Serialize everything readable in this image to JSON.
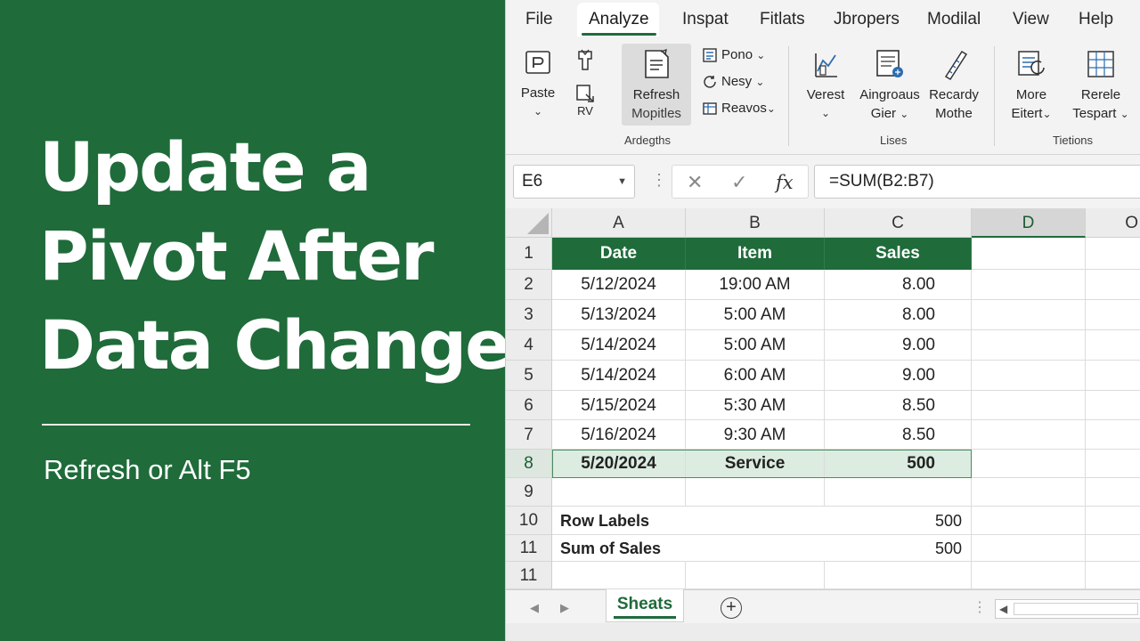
{
  "hero": {
    "title_lines": [
      "Update a",
      "Pivot After",
      "Data Changes"
    ],
    "subtitle": "Refresh or Alt F5"
  },
  "menu": {
    "items": [
      "File",
      "Analyze",
      "Inspat",
      "Fitlats",
      "Jbropers",
      "Modilal",
      "View",
      "Help"
    ],
    "active": "Analyze"
  },
  "ribbon": {
    "paste": {
      "label": "Paste"
    },
    "sub_small": {
      "label": "RV"
    },
    "refresh": {
      "line1": "Refresh",
      "line2": "Mopitles"
    },
    "pono": {
      "label": "Pono"
    },
    "nesy": {
      "label": "Nesy"
    },
    "reavos": {
      "label": "Reavos"
    },
    "group1_label": "Ardegths",
    "verest": {
      "label": "Verest"
    },
    "aingroaus": {
      "line1": "Aingroaus",
      "line2": "Gier"
    },
    "recardy": {
      "line1": "Recardy",
      "line2": "Mothe"
    },
    "group2_label": "Lises",
    "more": {
      "line1": "More",
      "line2": "Eitert"
    },
    "rerele": {
      "line1": "Rerele",
      "line2": "Tespart"
    },
    "group3_label": "Tietions"
  },
  "formula_bar": {
    "name_box": "E6",
    "cancel_icon": "✕",
    "enter_icon": "✓",
    "fx": "fx",
    "formula": "=SUM(B2:B7)"
  },
  "columns": [
    "A",
    "B",
    "C",
    "D",
    "O"
  ],
  "selected_column": "D",
  "table": {
    "headers": [
      "Date",
      "Item",
      "Sales"
    ],
    "rows": [
      {
        "row": "2",
        "date": "5/12/2024",
        "item": "19:00 AM",
        "sales": "8.00"
      },
      {
        "row": "3",
        "date": "5/13/2024",
        "item": "5:00 AM",
        "sales": "8.00"
      },
      {
        "row": "4",
        "date": "5/14/2024",
        "item": "5:00 AM",
        "sales": "9.00"
      },
      {
        "row": "5",
        "date": "5/14/2024",
        "item": "6:00 AM",
        "sales": "9.00"
      },
      {
        "row": "6",
        "date": "5/15/2024",
        "item": "5:30 AM",
        "sales": "8.50"
      },
      {
        "row": "7",
        "date": "5/16/2024",
        "item": "9:30 AM",
        "sales": "8.50"
      },
      {
        "row": "8",
        "date": "5/20/2024",
        "item": "Service",
        "sales": "500"
      }
    ]
  },
  "row_numbers": [
    "1",
    "2",
    "3",
    "4",
    "5",
    "6",
    "7",
    "8",
    "9",
    "10",
    "11",
    "11"
  ],
  "selected_row": "8",
  "pivot": {
    "row_labels": {
      "label": "Row Labels",
      "value": "500"
    },
    "sum_of_sales": {
      "label": "Sum of Sales",
      "value": "500"
    }
  },
  "sheets": {
    "active": "Sheats",
    "add_label": "+"
  },
  "colors": {
    "brand_green": "#1f6b3a",
    "highlight_row": "#dcece0"
  }
}
